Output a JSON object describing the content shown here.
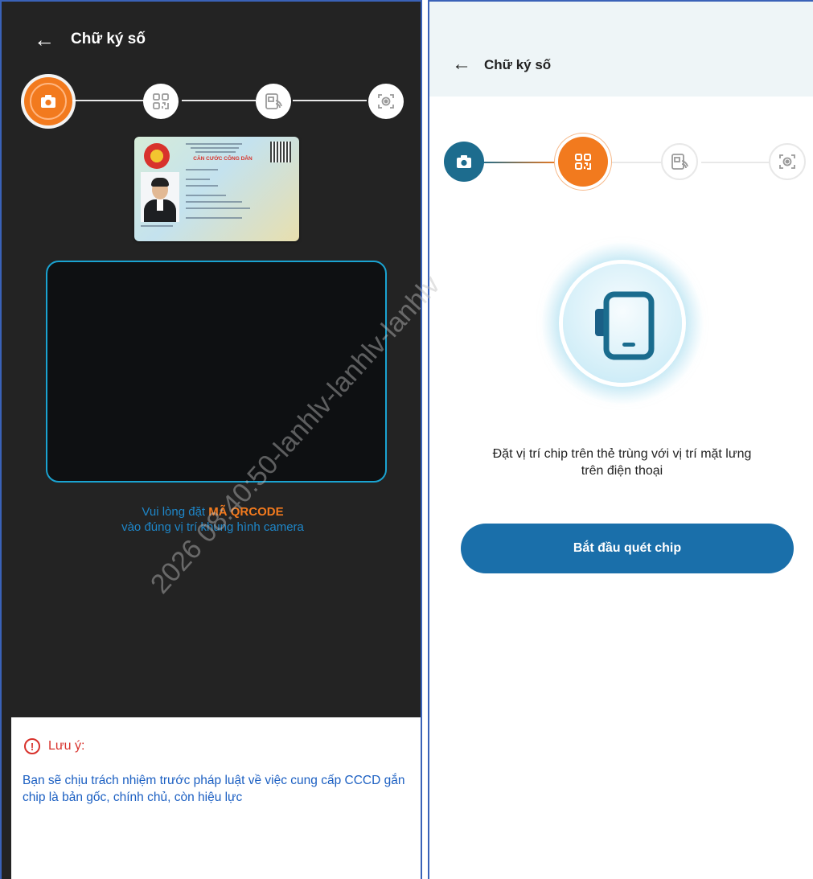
{
  "left_screen": {
    "header": {
      "back_icon": "arrow-left-icon",
      "title": "Chữ ký số"
    },
    "stepper": [
      {
        "icon": "camera-icon",
        "state": "active"
      },
      {
        "icon": "qrcode-icon",
        "state": "pending"
      },
      {
        "icon": "nfc-chip-icon",
        "state": "pending"
      },
      {
        "icon": "face-scan-icon",
        "state": "pending"
      }
    ],
    "id_card": {
      "title": "CĂN CƯỚC CÔNG DÂN",
      "alt": "sample-id-card-image"
    },
    "hint": {
      "prefix": "Vui lòng đặt ",
      "highlight": "MÃ QRCODE",
      "line2": "vào đúng vị trí khung hình camera"
    },
    "note": {
      "icon": "exclamation-circle-icon",
      "title": "Lưu ý:",
      "body": "Bạn sẽ chịu trách nhiệm trước pháp luật về việc cung cấp CCCD gắn chip là bản gốc, chính chủ, còn hiệu lực"
    },
    "colors": {
      "background": "#232323",
      "accent": "#f27a1e",
      "frame": "#1aa3d1",
      "warning": "#d8322c",
      "link": "#1b5fc2"
    }
  },
  "right_screen": {
    "header": {
      "back_icon": "arrow-left-icon",
      "title": "Chữ ký số"
    },
    "stepper": [
      {
        "icon": "camera-icon",
        "state": "done"
      },
      {
        "icon": "qrcode-icon",
        "state": "active"
      },
      {
        "icon": "nfc-chip-icon",
        "state": "pending"
      },
      {
        "icon": "face-scan-icon",
        "state": "pending"
      }
    ],
    "illustration_icon": "phone-chip-icon",
    "instruction_line1": "Đặt vị trí chip trên thẻ trùng với vị trí mặt lưng",
    "instruction_line2": "trên điện thoại",
    "start_button": "Bắt đầu quét chip",
    "colors": {
      "header_bg": "#eef5f7",
      "done": "#1d6c8e",
      "active": "#f27a1e",
      "button": "#1a6faa"
    }
  },
  "watermark": "2026 08:40:50-lanhlv-lanhlv-lanhlv"
}
